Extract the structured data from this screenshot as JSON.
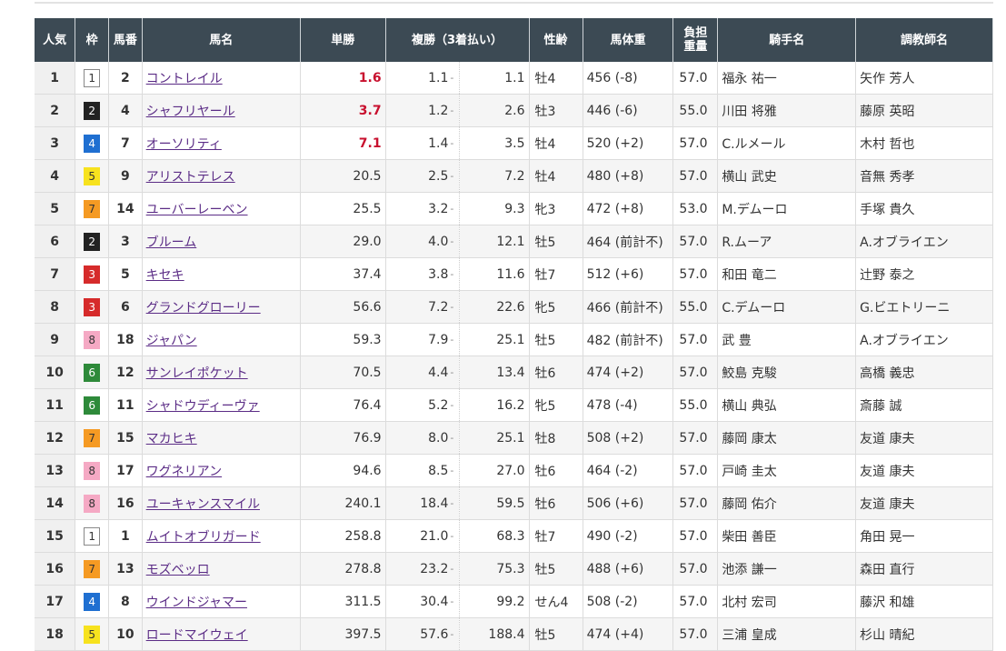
{
  "headers": {
    "popularity": "人気",
    "waku": "枠",
    "umaban": "馬番",
    "horse": "馬名",
    "win": "単勝",
    "place": "複勝（3着払い）",
    "sexage": "性齢",
    "weight": "馬体重",
    "load": "負担\n重量",
    "jockey": "騎手名",
    "trainer": "調教師名"
  },
  "rows": [
    {
      "pop": "1",
      "waku": "1",
      "wakucolor": "#ffffff",
      "wakutext": "#333",
      "num": "2",
      "horse": "コントレイル",
      "win": "1.6",
      "hl": true,
      "pmin": "1.1",
      "pmax": "1.1",
      "sexage": "牡4",
      "weight": "456 (-8)",
      "load": "57.0",
      "jockey": "福永 祐一",
      "jlink": true,
      "trainer": "矢作 芳人",
      "tlink": true
    },
    {
      "pop": "2",
      "waku": "2",
      "wakucolor": "#222222",
      "wakutext": "#fff",
      "num": "4",
      "horse": "シャフリヤール",
      "win": "3.7",
      "hl": true,
      "pmin": "1.2",
      "pmax": "2.6",
      "sexage": "牡3",
      "weight": "446 (-6)",
      "load": "55.0",
      "jockey": "川田 将雅",
      "jlink": true,
      "trainer": "藤原 英昭",
      "tlink": true
    },
    {
      "pop": "3",
      "waku": "4",
      "wakucolor": "#1f6fd1",
      "wakutext": "#fff",
      "num": "7",
      "horse": "オーソリティ",
      "win": "7.1",
      "hl": true,
      "pmin": "1.4",
      "pmax": "3.5",
      "sexage": "牡4",
      "weight": "520 (+2)",
      "load": "57.0",
      "jockey": "C.ルメール",
      "jlink": true,
      "trainer": "木村 哲也",
      "tlink": true
    },
    {
      "pop": "4",
      "waku": "5",
      "wakucolor": "#f7e21e",
      "wakutext": "#333",
      "num": "9",
      "horse": "アリストテレス",
      "win": "20.5",
      "hl": false,
      "pmin": "2.5",
      "pmax": "7.2",
      "sexage": "牡4",
      "weight": "480 (+8)",
      "load": "57.0",
      "jockey": "横山 武史",
      "jlink": true,
      "trainer": "音無 秀孝",
      "tlink": true
    },
    {
      "pop": "5",
      "waku": "7",
      "wakucolor": "#f59a23",
      "wakutext": "#333",
      "num": "14",
      "horse": "ユーバーレーベン",
      "win": "25.5",
      "hl": false,
      "pmin": "3.2",
      "pmax": "9.3",
      "sexage": "牝3",
      "weight": "472 (+8)",
      "load": "53.0",
      "jockey": "M.デムーロ",
      "jlink": true,
      "trainer": "手塚 貴久",
      "tlink": true
    },
    {
      "pop": "6",
      "waku": "2",
      "wakucolor": "#222222",
      "wakutext": "#fff",
      "num": "3",
      "horse": "ブルーム",
      "win": "29.0",
      "hl": false,
      "pmin": "4.0",
      "pmax": "12.1",
      "sexage": "牡5",
      "weight": "464 (前計不)",
      "load": "57.0",
      "jockey": "R.ムーア",
      "jlink": true,
      "trainer": "A.オブライエン",
      "tlink": false
    },
    {
      "pop": "7",
      "waku": "3",
      "wakucolor": "#d62b2b",
      "wakutext": "#fff",
      "num": "5",
      "horse": "キセキ",
      "win": "37.4",
      "hl": false,
      "pmin": "3.8",
      "pmax": "11.6",
      "sexage": "牡7",
      "weight": "512 (+6)",
      "load": "57.0",
      "jockey": "和田 竜二",
      "jlink": true,
      "trainer": "辻野 泰之",
      "tlink": true
    },
    {
      "pop": "8",
      "waku": "3",
      "wakucolor": "#d62b2b",
      "wakutext": "#fff",
      "num": "6",
      "horse": "グランドグローリー",
      "win": "56.6",
      "hl": false,
      "pmin": "7.2",
      "pmax": "22.6",
      "sexage": "牝5",
      "weight": "466 (前計不)",
      "load": "55.0",
      "jockey": "C.デムーロ",
      "jlink": true,
      "trainer": "G.ビエトリーニ",
      "tlink": false
    },
    {
      "pop": "9",
      "waku": "8",
      "wakucolor": "#f5a9c4",
      "wakutext": "#333",
      "num": "18",
      "horse": "ジャパン",
      "win": "59.3",
      "hl": false,
      "pmin": "7.9",
      "pmax": "25.1",
      "sexage": "牡5",
      "weight": "482 (前計不)",
      "load": "57.0",
      "jockey": "武 豊",
      "jlink": true,
      "trainer": "A.オブライエン",
      "tlink": false
    },
    {
      "pop": "10",
      "waku": "6",
      "wakucolor": "#2e8a3a",
      "wakutext": "#fff",
      "num": "12",
      "horse": "サンレイポケット",
      "win": "70.5",
      "hl": false,
      "pmin": "4.4",
      "pmax": "13.4",
      "sexage": "牡6",
      "weight": "474 (+2)",
      "load": "57.0",
      "jockey": "鮫島 克駿",
      "jlink": true,
      "trainer": "高橋 義忠",
      "tlink": true
    },
    {
      "pop": "11",
      "waku": "6",
      "wakucolor": "#2e8a3a",
      "wakutext": "#fff",
      "num": "11",
      "horse": "シャドウディーヴァ",
      "win": "76.4",
      "hl": false,
      "pmin": "5.2",
      "pmax": "16.2",
      "sexage": "牝5",
      "weight": "478 (-4)",
      "load": "55.0",
      "jockey": "横山 典弘",
      "jlink": true,
      "trainer": "斎藤 誠",
      "tlink": true
    },
    {
      "pop": "12",
      "waku": "7",
      "wakucolor": "#f59a23",
      "wakutext": "#333",
      "num": "15",
      "horse": "マカヒキ",
      "win": "76.9",
      "hl": false,
      "pmin": "8.0",
      "pmax": "25.1",
      "sexage": "牡8",
      "weight": "508 (+2)",
      "load": "57.0",
      "jockey": "藤岡 康太",
      "jlink": true,
      "trainer": "友道 康夫",
      "tlink": true
    },
    {
      "pop": "13",
      "waku": "8",
      "wakucolor": "#f5a9c4",
      "wakutext": "#333",
      "num": "17",
      "horse": "ワグネリアン",
      "win": "94.6",
      "hl": false,
      "pmin": "8.5",
      "pmax": "27.0",
      "sexage": "牡6",
      "weight": "464 (-2)",
      "load": "57.0",
      "jockey": "戸崎 圭太",
      "jlink": true,
      "trainer": "友道 康夫",
      "tlink": true
    },
    {
      "pop": "14",
      "waku": "8",
      "wakucolor": "#f5a9c4",
      "wakutext": "#333",
      "num": "16",
      "horse": "ユーキャンスマイル",
      "win": "240.1",
      "hl": false,
      "pmin": "18.4",
      "pmax": "59.5",
      "sexage": "牡6",
      "weight": "506 (+6)",
      "load": "57.0",
      "jockey": "藤岡 佑介",
      "jlink": true,
      "trainer": "友道 康夫",
      "tlink": true
    },
    {
      "pop": "15",
      "waku": "1",
      "wakucolor": "#ffffff",
      "wakutext": "#333",
      "num": "1",
      "horse": "ムイトオブリガード",
      "win": "258.8",
      "hl": false,
      "pmin": "21.0",
      "pmax": "68.3",
      "sexage": "牡7",
      "weight": "490 (-2)",
      "load": "57.0",
      "jockey": "柴田 善臣",
      "jlink": true,
      "trainer": "角田 晃一",
      "tlink": true
    },
    {
      "pop": "16",
      "waku": "7",
      "wakucolor": "#f59a23",
      "wakutext": "#333",
      "num": "13",
      "horse": "モズベッロ",
      "win": "278.8",
      "hl": false,
      "pmin": "23.2",
      "pmax": "75.3",
      "sexage": "牡5",
      "weight": "488 (+6)",
      "load": "57.0",
      "jockey": "池添 謙一",
      "jlink": true,
      "trainer": "森田 直行",
      "tlink": true
    },
    {
      "pop": "17",
      "waku": "4",
      "wakucolor": "#1f6fd1",
      "wakutext": "#fff",
      "num": "8",
      "horse": "ウインドジャマー",
      "win": "311.5",
      "hl": false,
      "pmin": "30.4",
      "pmax": "99.2",
      "sexage": "せん4",
      "weight": "508 (-2)",
      "load": "57.0",
      "jockey": "北村 宏司",
      "jlink": true,
      "trainer": "藤沢 和雄",
      "tlink": true
    },
    {
      "pop": "18",
      "waku": "5",
      "wakucolor": "#f7e21e",
      "wakutext": "#333",
      "num": "10",
      "horse": "ロードマイウェイ",
      "win": "397.5",
      "hl": false,
      "pmin": "57.6",
      "pmax": "188.4",
      "sexage": "牡5",
      "weight": "474 (+4)",
      "load": "57.0",
      "jockey": "三浦 皇成",
      "jlink": true,
      "trainer": "杉山 晴紀",
      "tlink": true
    }
  ]
}
